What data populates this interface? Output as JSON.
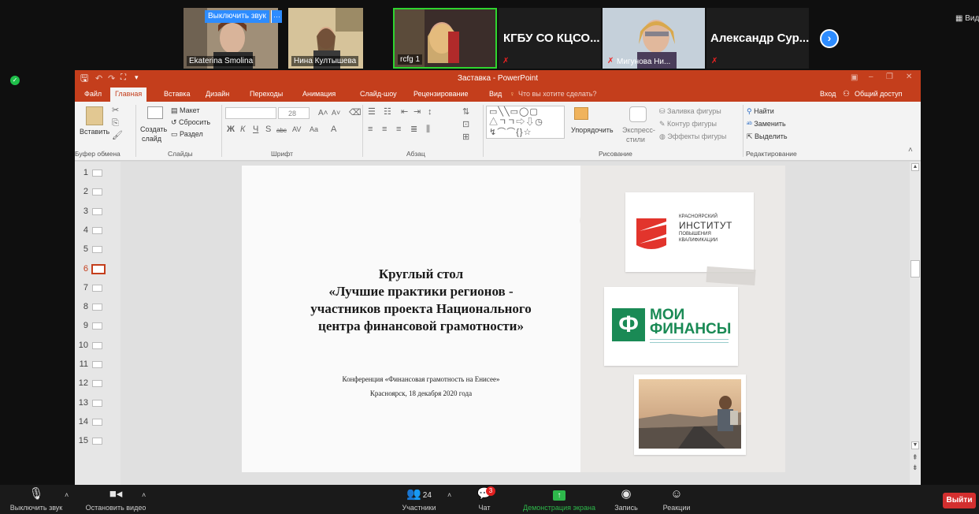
{
  "zoom": {
    "unmute_tooltip": "Выключить звук",
    "more_dots": "···",
    "view_label": "▦ Вид",
    "participants": [
      {
        "name": "Ekaterina Smolina"
      },
      {
        "name": "Нина Култышева"
      },
      {
        "name": "rcfg 1"
      },
      {
        "name": "КГБУ СО КЦСО..."
      },
      {
        "name": "Мигунова Ни..."
      },
      {
        "name": "Александр Сур..."
      }
    ],
    "next_icon": "chevron-right-icon",
    "security_icon": "shield-icon",
    "controls": {
      "mute": "Выключить звук",
      "stop_video": "Остановить видео",
      "participants": "Участники",
      "participants_count": "24",
      "chat": "Чат",
      "chat_badge": "3",
      "share": "Демонстрация экрана",
      "record": "Запись",
      "reactions": "Реакции",
      "leave": "Выйти"
    },
    "colors": {
      "leave": "#d32f2f",
      "share": "#2eb84b",
      "accent": "#2d8cff"
    }
  },
  "ppt": {
    "window_title": "Заставка - PowerPoint",
    "window_buttons": [
      "▣",
      "–",
      "❐",
      "✕"
    ],
    "tabs": [
      "Файл",
      "Главная",
      "Вставка",
      "Дизайн",
      "Переходы",
      "Анимация",
      "Слайд-шоу",
      "Рецензирование",
      "Вид"
    ],
    "tell_me": "Что вы хотите сделать?",
    "sign_in": "Вход",
    "share": "Общий доступ",
    "ribbon": {
      "paste": "Вставить",
      "clipboard_group": "Буфер обмена",
      "new_slide": "Создать",
      "new_slide_2": "слайд",
      "layout": "Макет",
      "reset": "Сбросить",
      "section": "Раздел",
      "slides_group": "Слайды",
      "font_size": "28",
      "font_group": "Шрифт",
      "paragraph_group": "Абзац",
      "arrange": "Упорядочить",
      "quick_styles": "Экспресс-",
      "quick_styles_2": "стили",
      "shape_fill": "Заливка фигуры",
      "shape_outline": "Контур фигуры",
      "shape_effects": "Эффекты фигуры",
      "drawing_group": "Рисование",
      "find": "Найти",
      "replace": "Заменить",
      "select": "Выделить",
      "editing_group": "Редактирование",
      "font_buttons": [
        "Ж",
        "К",
        "Ч",
        "S",
        "abc",
        "AV",
        "Aa",
        "A"
      ]
    },
    "slide_numbers": [
      "1",
      "2",
      "3",
      "4",
      "5",
      "6",
      "7",
      "8",
      "9",
      "10",
      "11",
      "12",
      "13",
      "14",
      "15"
    ],
    "selected_slide": "6",
    "slide": {
      "title_lines": [
        "Круглый стол",
        "«Лучшие практики регионов -",
        "участников проекта Национального",
        "центра финансовой грамотности»"
      ],
      "subtitle_lines": [
        "Конференция «Финансовая грамотность на Енисее»",
        "Красноярск, 18 декабря 2020 года"
      ],
      "logo1_lines": [
        "КРАСНОЯРСКИЙ",
        "ИНСТИТУТ",
        "ПОВЫШЕНИЯ",
        "КВАЛИФИКАЦИИ"
      ],
      "logo2_lines": [
        "МОИ",
        "ФИНАНСЫ"
      ],
      "logo2_symbol": "Ф",
      "colors": {
        "ppt_accent": "#c43e1c",
        "logo1_red": "#e2342c",
        "logo2_green": "#1a8a55"
      }
    }
  }
}
